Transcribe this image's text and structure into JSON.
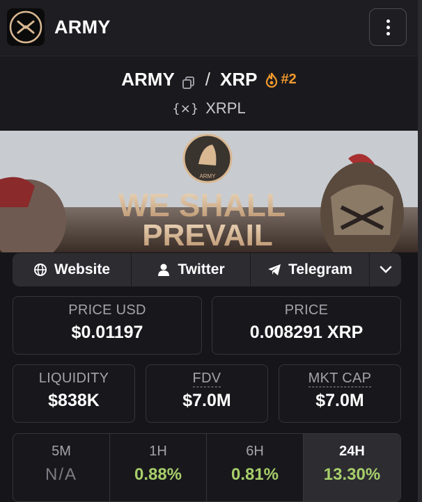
{
  "app": {
    "title": "ARMY"
  },
  "pair": {
    "base": "ARMY",
    "separator": "/",
    "quote": "XRP",
    "rank": "#2",
    "chain": "XRPL"
  },
  "banner": {
    "line1": "WE SHALL",
    "line2": "PREVAIL",
    "logo_text": "ARMY"
  },
  "links": {
    "website": "Website",
    "twitter": "Twitter",
    "telegram": "Telegram"
  },
  "stats": {
    "price_usd_label": "PRICE USD",
    "price_usd": "$0.01197",
    "price_label": "PRICE",
    "price": "0.008291 XRP",
    "liquidity_label": "LIQUIDITY",
    "liquidity": "$838K",
    "fdv_label": "FDV",
    "fdv": "$7.0M",
    "mktcap_label": "MKT CAP",
    "mktcap": "$7.0M"
  },
  "changes": [
    {
      "period": "5M",
      "value": "N/A"
    },
    {
      "period": "1H",
      "value": "0.88%"
    },
    {
      "period": "6H",
      "value": "0.81%"
    },
    {
      "period": "24H",
      "value": "13.30%"
    }
  ],
  "colors": {
    "positive": "#a7cf6a",
    "rank": "#f29a2e",
    "gold": "#d9b892"
  },
  "icons": [
    "army-logo-icon",
    "kebab-menu-icon",
    "copy-icon",
    "fire-icon",
    "xrpl-icon",
    "globe-icon",
    "user-icon",
    "telegram-icon",
    "chevron-down-icon"
  ]
}
